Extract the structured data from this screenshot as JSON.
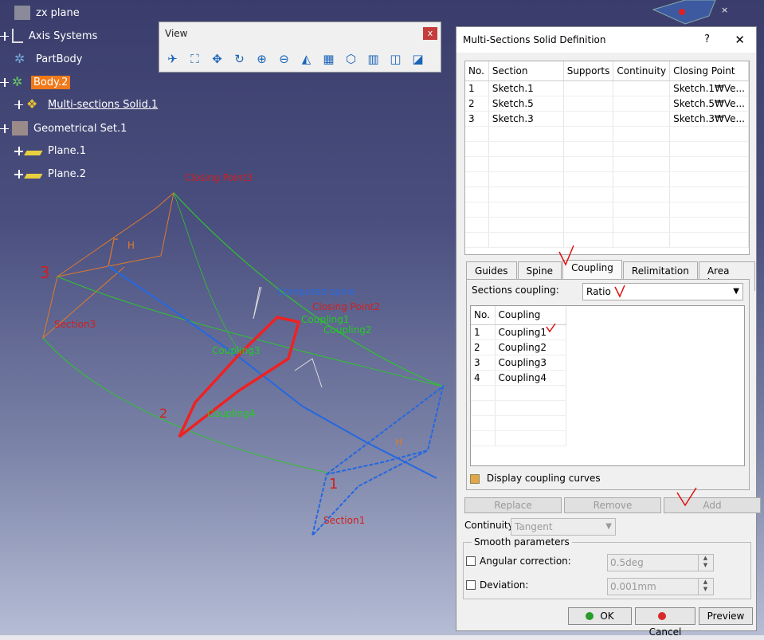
{
  "tree": {
    "items": [
      {
        "label": "zx plane",
        "selected": false,
        "underline": false
      },
      {
        "label": "Axis Systems",
        "selected": false,
        "underline": false
      },
      {
        "label": "PartBody",
        "selected": false,
        "underline": false
      },
      {
        "label": "Body.2",
        "selected": true,
        "underline": false
      },
      {
        "label": "Multi-sections Solid.1",
        "selected": false,
        "underline": true
      },
      {
        "label": "Geometrical Set.1",
        "selected": false,
        "underline": false
      },
      {
        "label": "Plane.1",
        "selected": false,
        "underline": false
      },
      {
        "label": "Plane.2",
        "selected": false,
        "underline": false
      }
    ]
  },
  "view_toolbar": {
    "title": "View",
    "close": "x",
    "tools": [
      "fly-mode-icon",
      "fit-all-icon",
      "pan-icon",
      "rotate-icon",
      "zoom-in-icon",
      "zoom-out-icon",
      "normal-view-icon",
      "multi-view-icon",
      "iso-view-icon",
      "shading-icon",
      "hide-show-icon",
      "swap-visible-icon"
    ]
  },
  "viewport_labels": {
    "closing_point3": "Closing Point3",
    "closing_point2": "Closing Point2",
    "computed_spine": "Computed spine",
    "coupling1": "Coupling1",
    "coupling2": "Coupling2",
    "coupling3": "Coupling3",
    "coupling4": "Coupling4",
    "section3": "Section3",
    "section1": "Section1",
    "num_3": "3",
    "num_2": "2",
    "num_1": "1",
    "h_label": "H"
  },
  "dialog": {
    "title": "Multi-Sections Solid Definition",
    "help": "?",
    "close": "✕",
    "columns": [
      "No.",
      "Section",
      "Supports",
      "Continuity",
      "Closing Point"
    ],
    "rows": [
      {
        "no": "1",
        "section": "Sketch.1",
        "supports": "",
        "continuity": "",
        "closing": "Sketch.1₩Ve..."
      },
      {
        "no": "2",
        "section": "Sketch.5",
        "supports": "",
        "continuity": "",
        "closing": "Sketch.5₩Ve..."
      },
      {
        "no": "3",
        "section": "Sketch.3",
        "supports": "",
        "continuity": "",
        "closing": "Sketch.3₩Ve..."
      }
    ],
    "tabs": [
      "Guides",
      "Spine",
      "Coupling",
      "Relimitation",
      "Area Law"
    ],
    "active_tab": "Coupling",
    "sections_coupling_label": "Sections coupling:",
    "sections_coupling_value": "Ratio",
    "coupling_columns": [
      "No.",
      "Coupling"
    ],
    "couplings": [
      {
        "no": "1",
        "name": "Coupling1"
      },
      {
        "no": "2",
        "name": "Coupling2"
      },
      {
        "no": "3",
        "name": "Coupling3"
      },
      {
        "no": "4",
        "name": "Coupling4"
      }
    ],
    "display_coupling_curves": "Display coupling curves",
    "replace": "Replace",
    "remove": "Remove",
    "add": "Add",
    "continuity_label": "Continuity:",
    "continuity_value": "Tangent",
    "smooth_title": "Smooth parameters",
    "angular_label": "Angular correction:",
    "angular_value": "0.5deg",
    "deviation_label": "Deviation:",
    "deviation_value": "0.001mm",
    "ok": "OK",
    "cancel": "Cancel",
    "preview": "Preview"
  }
}
